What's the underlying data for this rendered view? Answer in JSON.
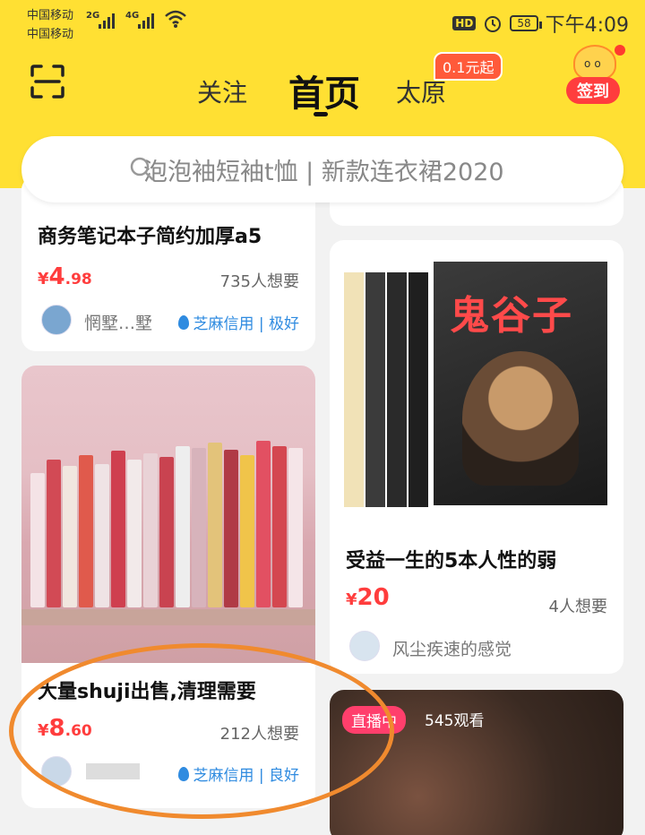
{
  "status_bar": {
    "carrier1": "中国移动",
    "carrier2": "中国移动",
    "sig1": "2G",
    "sig2": "4G",
    "hd": "HD",
    "battery": "58",
    "time": "下午4:09"
  },
  "header": {
    "tabs": [
      {
        "label": "关注"
      },
      {
        "label": "首页"
      },
      {
        "label": "太原"
      }
    ],
    "promo": "0.1元起",
    "checkin": "签到"
  },
  "search": {
    "placeholder": "泡泡袖短袖t恤 | 新款连衣裙2020"
  },
  "cards": [
    {
      "title": "商务笔记本子简约加厚a5",
      "price_yen": "¥",
      "price_int": "4",
      "price_dec": ".98",
      "want": "735人想要",
      "seller": "惘墅…墅",
      "credit": "芝麻信用 | 极好"
    },
    {
      "title": "大量shuji出售,清理需要",
      "price_yen": "¥",
      "price_int": "8",
      "price_dec": ".60",
      "want": "212人想要",
      "credit": "芝麻信用 | 良好"
    },
    {
      "title": "受益一生的5本人性的弱",
      "price_yen": "¥",
      "price_int": "20",
      "want": "4人想要",
      "seller": "风尘疾速的感觉",
      "cover_title": "鬼谷子"
    },
    {
      "live_badge": "直播中",
      "live_count": "545观看"
    }
  ],
  "colors": {
    "header_bg": "#ffe033",
    "price": "#ff3d3d",
    "credit": "#2f8be0",
    "live": "#ff3f6c",
    "highlight_circle": "#f08a2e"
  },
  "icons": [
    "scan-icon",
    "search-icon",
    "alipay-credit-icon",
    "wifi-icon",
    "alarm-icon"
  ]
}
